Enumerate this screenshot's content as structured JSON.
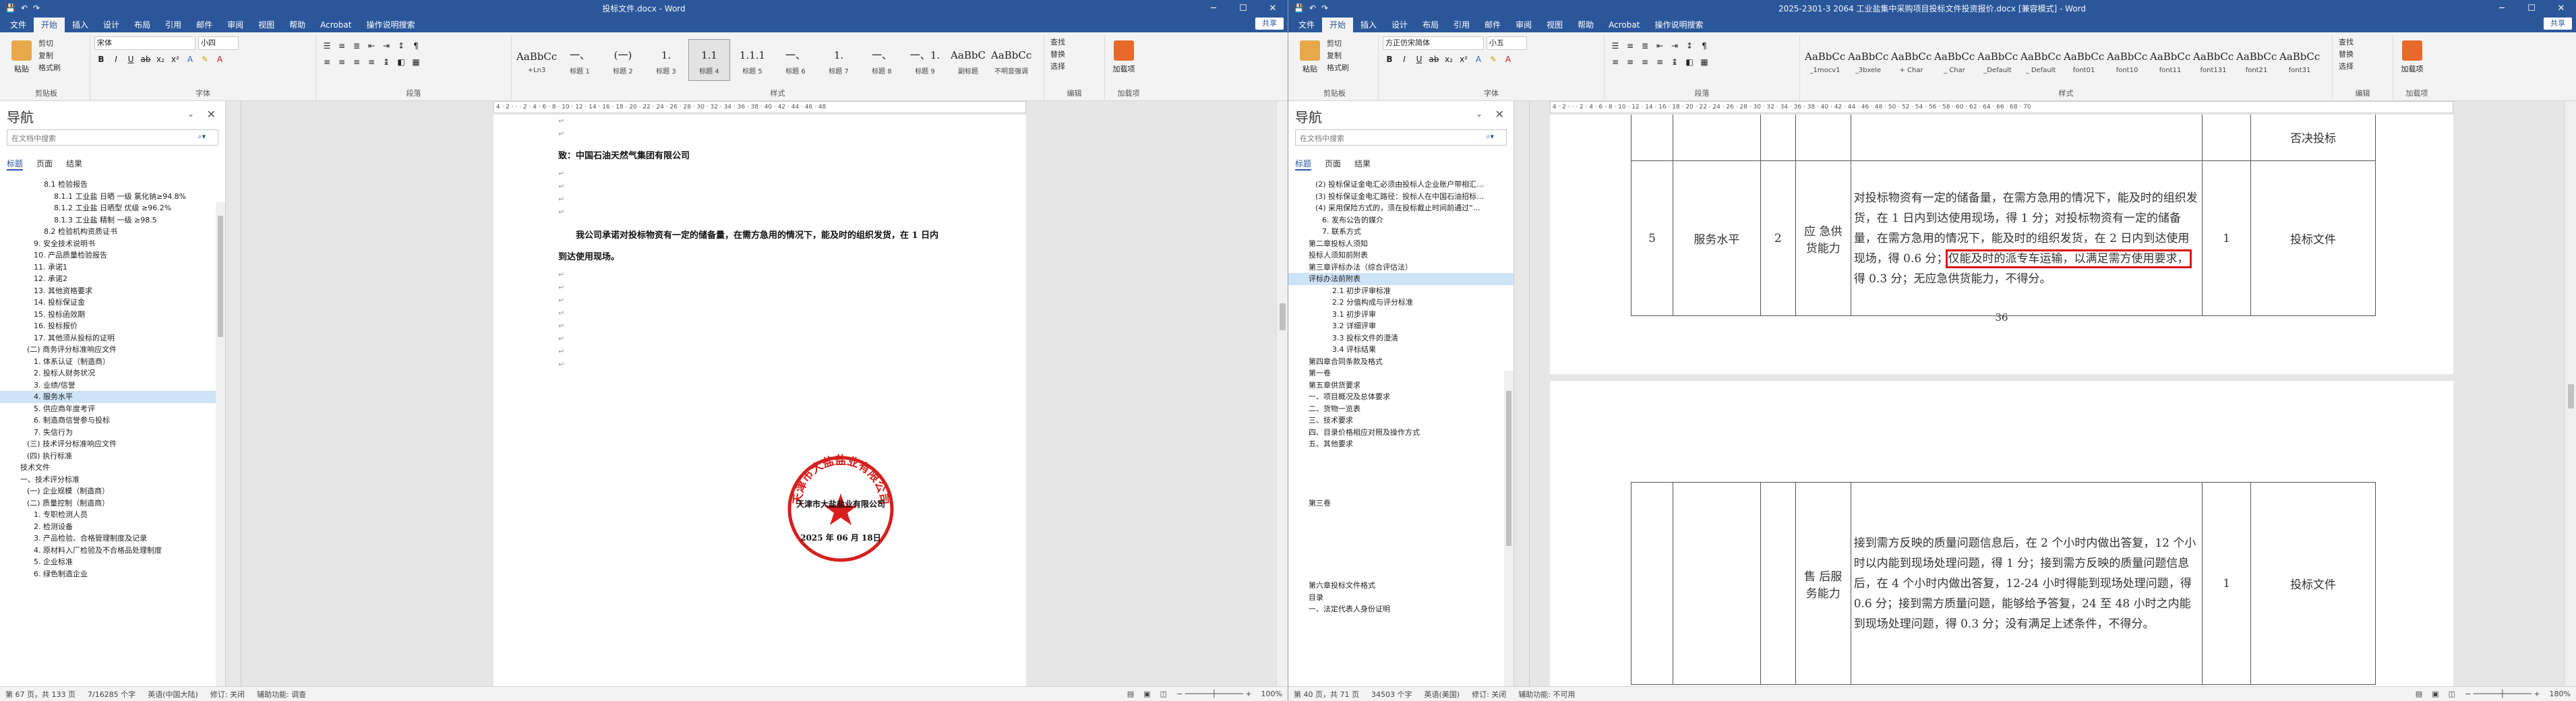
{
  "tabs": [
    "文件",
    "开始",
    "插入",
    "设计",
    "布局",
    "引用",
    "邮件",
    "审阅",
    "视图",
    "帮助",
    "Acrobat",
    "操作说明搜索"
  ],
  "share_label": "共享",
  "win1": {
    "title": "投标文件.docx - Word",
    "font_name": "宋体",
    "font_size": "小四",
    "styles": [
      {
        "pv": "AaBbCcI",
        "name": "+Ln3"
      },
      {
        "pv": "一、",
        "name": "标题 1"
      },
      {
        "pv": "(一)",
        "name": "标题 2"
      },
      {
        "pv": "1.",
        "name": "标题 3"
      },
      {
        "pv": "1.1",
        "name": "标题 4"
      },
      {
        "pv": "1.1.1",
        "name": "标题 5"
      },
      {
        "pv": "一、",
        "name": "标题 6"
      },
      {
        "pv": "1.",
        "name": "标题 7"
      },
      {
        "pv": "一、",
        "name": "标题 8"
      },
      {
        "pv": "一、1.",
        "name": "标题 9"
      },
      {
        "pv": "AaBbC",
        "name": "副标题"
      },
      {
        "pv": "AaBbCcD",
        "name": "不明显强调"
      }
    ],
    "groups": [
      "剪贴板",
      "字体",
      "段落",
      "样式",
      "编辑",
      "加载项"
    ],
    "clipboard": [
      "剪切",
      "复制",
      "格式刷"
    ],
    "paste": "粘贴",
    "editing": [
      "查找",
      "替换",
      "选择"
    ],
    "addin": "加载项",
    "nav": {
      "title": "导航",
      "search": "在文档中搜索",
      "tabs": [
        "标题",
        "页面",
        "结果"
      ],
      "items": [
        "8.1 检验报告",
        "8.1.1 工业盐 日晒 一级 氯化钠≥94.8%",
        "8.1.2 工业盐 日晒型 优级 ≥96.2%",
        "8.1.3 工业盐 精制 一级 ≥98.5",
        "8.2 检验机构资质证书",
        "9. 安全技术说明书",
        "10. 产品质量检验报告",
        "11. 承诺1",
        "12. 承诺2",
        "13. 其他资格要求",
        "14. 投标保证金",
        "15. 投标函效期",
        "16. 投标报价",
        "17. 其他须从投标的证明",
        "(二) 商务评分标准响应文件",
        "1. 体系认证（制造商）",
        "2. 投标人财务状况",
        "3. 业绩/信誉",
        "4. 服务水平",
        "5. 供应商年度考评",
        "6. 制造商信誉参与投标",
        "7. 失信行为",
        "(三) 技术评分标准响应文件",
        "(四) 执行标准",
        "技术文件",
        "一、技术评分标准",
        "(一) 企业规模（制造商）",
        "(二) 质量控制（制造商）",
        "1. 专职检测人员",
        "2. 检测设备",
        "3. 产品检验、合格管理制度及记录",
        "4. 原材料入厂检验及不合格品处理制度",
        "5. 企业标准",
        "6. 绿色制造企业"
      ],
      "selected": 18
    },
    "doc": {
      "greeting": "致：中国石油天然气集团有限公司",
      "para1": "我公司承诺对投标物资有一定的储备量，在需方急用的情况下，能及时的组织发货，在 1 日内",
      "para2": "到达使用现场。",
      "seal_top": "天津市大盐盐业有限公司",
      "seal_company": "天津市大盐盐业有限公司",
      "seal_date": "2025 年 06 月 18日"
    },
    "status": {
      "page": "第 67 页，共 133 页",
      "words": "7/16285 个字",
      "lang": "英语(中国大陆)",
      "track": "修订: 关闭",
      "access": "辅助功能: 调查",
      "zoom": "100%"
    }
  },
  "win2": {
    "title": "2025-2301-3 2064 工业盐集中采购项目投标文件投资报价.docx [兼容模式] - Word",
    "font_name": "方正仿宋简体",
    "font_size": "小五",
    "styles": [
      {
        "pv": "AaBbCcC",
        "name": "_1mocv1"
      },
      {
        "pv": "AaBbCcC",
        "name": "_3bxele"
      },
      {
        "pv": "AaBbCcD",
        "name": "+ Char"
      },
      {
        "pv": "AaBbCcI",
        "name": "_ Char"
      },
      {
        "pv": "AaBbCcDc",
        "name": "_Default"
      },
      {
        "pv": "AaBbCcDc",
        "name": "_ Default"
      },
      {
        "pv": "AaBbCcDc",
        "name": "font01"
      },
      {
        "pv": "AaBbCcD",
        "name": "font10"
      },
      {
        "pv": "AaBbCcDc",
        "name": "font11"
      },
      {
        "pv": "AaBbCcDd",
        "name": "font131"
      },
      {
        "pv": "AaBbCcDd",
        "name": "font21"
      },
      {
        "pv": "AaBbCc",
        "name": "font31"
      }
    ],
    "groups": [
      "剪贴板",
      "字体",
      "段落",
      "样式",
      "编辑",
      "加载项"
    ],
    "clipboard": [
      "剪切",
      "复制",
      "格式刷"
    ],
    "paste": "粘贴",
    "editing": [
      "查找",
      "替换",
      "选择"
    ],
    "addin": "加载项",
    "nav": {
      "title": "导航",
      "search": "在文档中搜索",
      "tabs": [
        "标题",
        "页面",
        "结果"
      ],
      "items": [
        "(2) 投标保证金电汇必须由投标人企业账户带相汇…",
        "(3) 投标保证金电汇路径：投标人在中国石油招标…",
        "(4) 采用保险方式的，须在投标截止时间前通过“…",
        "6. 发布公告的媒介",
        "7. 联系方式",
        "第二章投标人须知",
        "投标人须知前附表",
        "第三章评标办法（综合评估法）",
        "评标办法前附表",
        "2.1 初步评审标准",
        "2.2 分值构成与评分标准",
        "3.1 初步评审",
        "3.2 详细评审",
        "3.3 投标文件的澄清",
        "3.4 评标结果",
        "第四章合同条款及格式",
        "第一卷",
        "第五章供货要求",
        "一、项目概况及总体要求",
        "二、货物一览表",
        "三、技术要求",
        "四、目录价格相应对照及操作方式",
        "五、其他要求",
        "",
        "",
        "",
        "",
        "第三卷",
        "",
        "",
        "",
        "",
        "",
        "",
        "第六章投标文件格式",
        "目录",
        "一、法定代表人身份证明"
      ],
      "selected": 8
    },
    "table": {
      "row1": {
        "no": "5",
        "item": "服务水平",
        "score": "2",
        "sub": "应 急供货能力",
        "desc_a": "对投标物资有一定的储备量，在需方急用的情况下，能及时的组织发货，在 1 日内到达使用现场，得 1 分；对投标物资有一定的储备量，在需方急用的情况下，能及时的组织发货，在 2 日内到达使用现场，得 0.6 分；",
        "desc_hl": "仅能及时的派专车运输，以满足需方使用要求，",
        "desc_b": "得 0.3 分；无应急供货能力，不得分。",
        "pts": "1",
        "src": "投标文件"
      },
      "top_src": "否决投标",
      "page_no": "36",
      "row2": {
        "sub": "售 后服务能力",
        "desc": "接到需方反映的质量问题信息后，在 2 个小时内做出答复，12 个小时以内能到现场处理问题，得 1 分；接到需方反映的质量问题信息后，在 4 个小时内做出答复，12-24 小时得能到现场处理问题，得 0.6 分；接到需方质量问题，能够给予答复，24 至 48 小时之内能到现场处理问题，得 0.3 分；没有满足上述条件，不得分。",
        "pts": "1",
        "src": "投标文件"
      }
    },
    "status": {
      "page": "第 40 页，共 71 页",
      "words": "34503 个字",
      "lang": "英语(美国)",
      "track": "修订: 关闭",
      "access": "辅助功能: 不可用",
      "zoom": "180%"
    }
  },
  "accent": "#2b579a",
  "seal_color": "#d61f1f",
  "highlight_color": "#dd1111"
}
